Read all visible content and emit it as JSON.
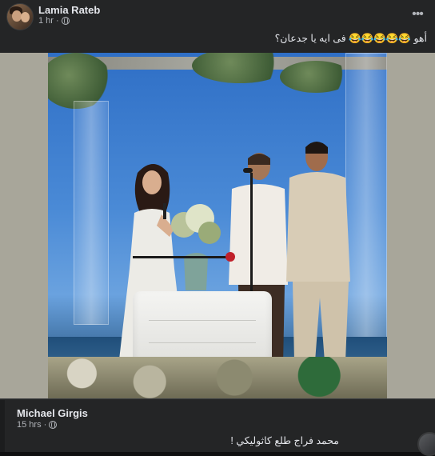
{
  "post": {
    "author": "Lamia Rateb",
    "time": "1 hr",
    "privacy_icon": "globe-icon",
    "more_icon": "more-dots-icon",
    "text": "أهو 😂😂😂😂😂 فى ايه يا جدعان؟"
  },
  "media": {
    "alt_icon": "photo-icon"
  },
  "comment": {
    "author": "Michael Girgis",
    "time": "15 hrs",
    "privacy_icon": "globe-icon",
    "text": "محمد فراج طلع كاثوليكي !"
  },
  "colors": {
    "background": "#242526",
    "text_primary": "#e4e6eb",
    "text_secondary": "#b0b3b8"
  }
}
